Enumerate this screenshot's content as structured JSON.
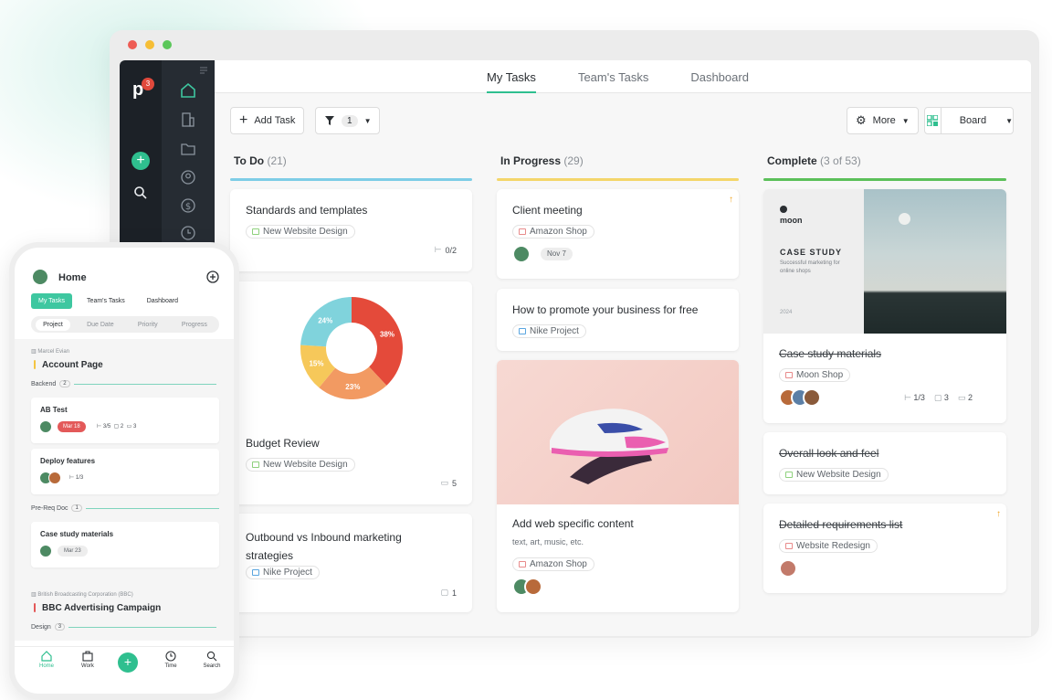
{
  "desktop": {
    "sidebar": {
      "logo_letter": "p",
      "logo_badge": "3"
    },
    "tabs": [
      {
        "label": "My Tasks",
        "active": true
      },
      {
        "label": "Team's Tasks",
        "active": false
      },
      {
        "label": "Dashboard",
        "active": false
      }
    ],
    "toolbar": {
      "add_task": "Add Task",
      "filter_count": "1",
      "more": "More",
      "view": "Board"
    },
    "columns": {
      "todo": {
        "title": "To Do",
        "count": "(21)",
        "color": "#7ecde6"
      },
      "progress": {
        "title": "In Progress",
        "count": "(29)",
        "color": "#f4d66a"
      },
      "complete": {
        "title": "Complete",
        "count": "(3 of 53)",
        "color": "#5cc05a"
      }
    },
    "cards": {
      "standards": {
        "title": "Standards and templates",
        "tag": "New Website Design",
        "subtasks": "0/2"
      },
      "budget": {
        "title": "Budget Review",
        "tag": "New Website Design",
        "files": "5",
        "chart_data": {
          "type": "pie",
          "categories": [
            "38%",
            "23%",
            "15%",
            "24%"
          ],
          "values": [
            38,
            23,
            15,
            24
          ],
          "colors": [
            "#e44a3a",
            "#f29a62",
            "#f6c85a",
            "#80d3dc"
          ]
        }
      },
      "outbound": {
        "title": "Outbound vs Inbound marketing strategies",
        "tag": "Nike Project",
        "comments": "1"
      },
      "client_meeting": {
        "title": "Client meeting",
        "tag": "Amazon Shop",
        "date": "Nov 7"
      },
      "promote": {
        "title": "How to promote your business for free",
        "tag": "Nike Project"
      },
      "web_content": {
        "title": "Add web specific content",
        "desc": "text, art, music, etc.",
        "tag": "Amazon Shop"
      },
      "case_study": {
        "brand": "moon",
        "heading": "CASE STUDY",
        "subheading": "Successful marketing for online shops",
        "year": "2024",
        "title": "Case study materials",
        "tag": "Moon Shop",
        "subtasks": "1/3",
        "comments": "3",
        "files": "2"
      },
      "overall": {
        "title": "Overall look and feel",
        "tag": "New Website Design"
      },
      "requirements": {
        "title": "Detailed requirements list",
        "tag": "Website Redesign"
      }
    }
  },
  "mobile": {
    "title": "Home",
    "tabs": [
      "My Tasks",
      "Team's Tasks",
      "Dashboard"
    ],
    "segments": [
      "Project",
      "Due Date",
      "Priority",
      "Progress"
    ],
    "project1": {
      "owner": "Marcel Evian",
      "name": "Account Page",
      "group1": {
        "name": "Backend",
        "count": "2"
      },
      "task1": {
        "title": "AB Test",
        "date": "Mar 18",
        "subtasks": "3/5",
        "comments": "2",
        "files": "3"
      },
      "task2": {
        "title": "Deploy features",
        "subtasks": "1/3"
      },
      "group2": {
        "name": "Pre-Req Doc",
        "count": "1"
      },
      "task3": {
        "title": "Case study materials",
        "date": "Mar 23"
      }
    },
    "project2": {
      "owner": "British Broadcasting Corporation (BBC)",
      "name": "BBC Advertising Campaign",
      "group1": {
        "name": "Design",
        "count": "3"
      }
    },
    "nav": [
      "Home",
      "Work",
      "Time",
      "Search"
    ]
  }
}
